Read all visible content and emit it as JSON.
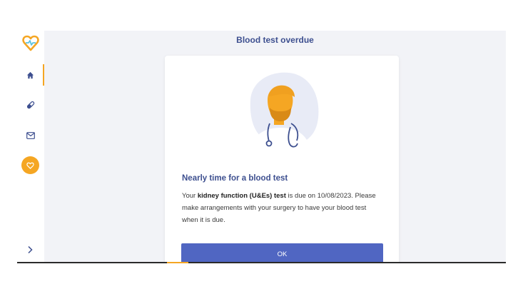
{
  "app": {
    "page_title": "Blood test overdue"
  },
  "sidebar": {
    "items": [
      {
        "name": "home",
        "icon": "home-icon",
        "active": true
      },
      {
        "name": "medications",
        "icon": "pill-icon",
        "active": false
      },
      {
        "name": "messages",
        "icon": "mail-icon",
        "active": false
      },
      {
        "name": "health",
        "icon": "heart-icon",
        "active": false
      }
    ],
    "expand_icon": "chevron-right-icon"
  },
  "card": {
    "heading": "Nearly time for a blood test",
    "body_prefix": "Your ",
    "body_bold": "kidney function (U&Es) test",
    "body_suffix": " is due on 10/08/2023. Please make arrangements with your surgery to have your blood test when it is due.",
    "ok_label": "OK"
  },
  "colors": {
    "brand_blue": "#3d4f8f",
    "button_blue": "#5066c2",
    "accent_orange": "#f5a623",
    "background": "#f2f3f7"
  }
}
